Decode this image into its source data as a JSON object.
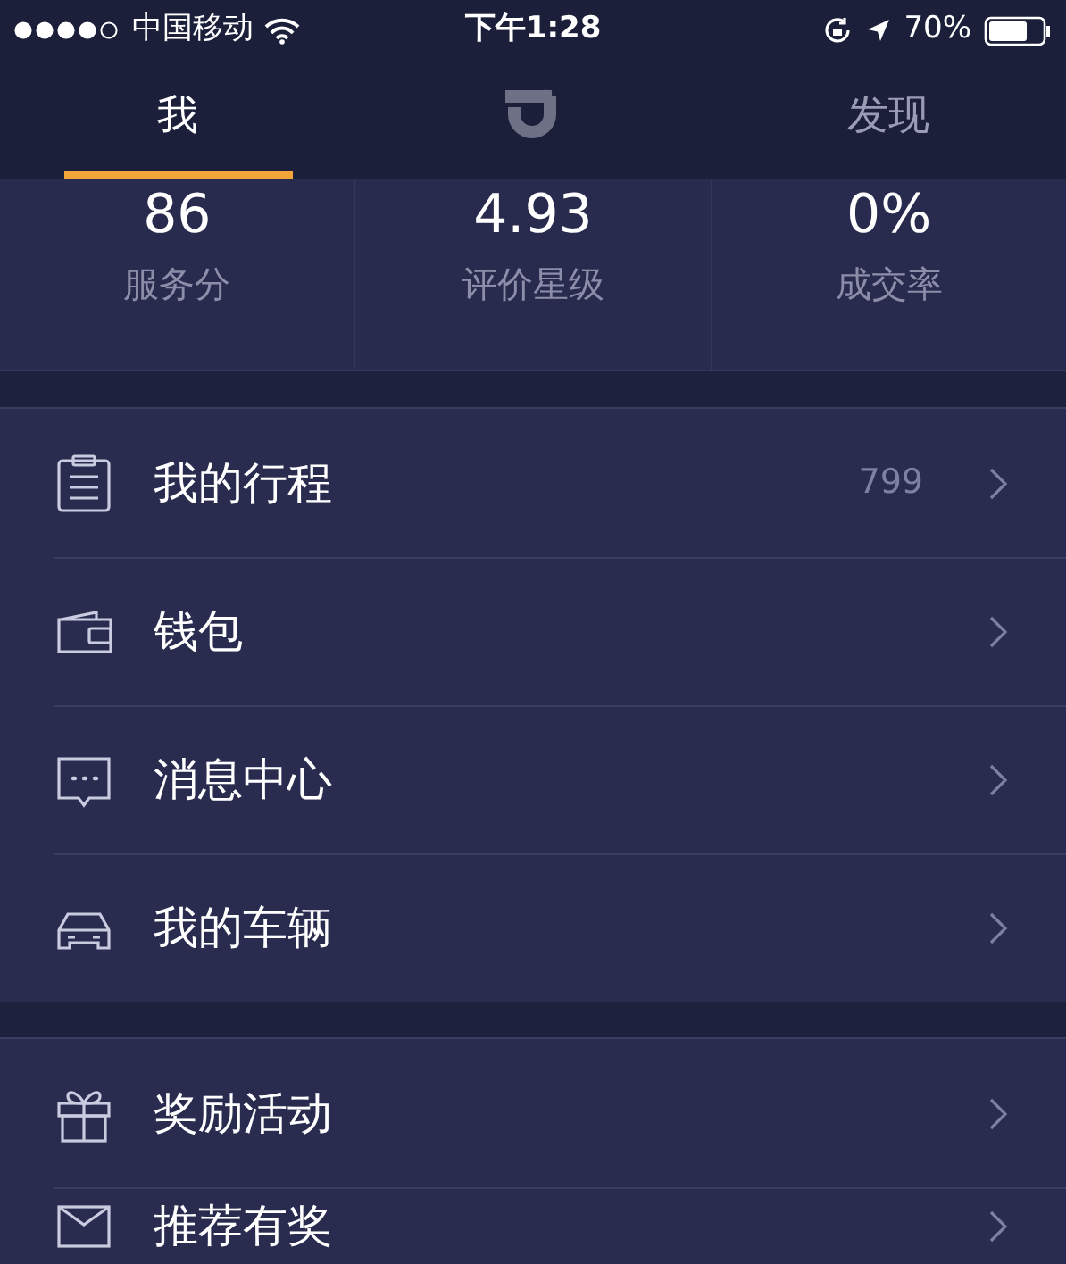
{
  "status_bar": {
    "carrier": "中国移动",
    "time": "下午1:28",
    "battery": "70%"
  },
  "tabs": [
    {
      "kind": "text",
      "label": "我",
      "selected": true
    },
    {
      "kind": "logo",
      "selected": false
    },
    {
      "kind": "text",
      "label": "发现",
      "selected": false
    }
  ],
  "stats": [
    {
      "value": "86",
      "label": "服务分"
    },
    {
      "value": "4.93",
      "label": "评价星级"
    },
    {
      "value": "0%",
      "label": "成交率"
    }
  ],
  "menu_groups": [
    {
      "items": [
        {
          "label": "我的行程",
          "count": "799"
        },
        {
          "label": "钱包"
        },
        {
          "label": "消息中心"
        },
        {
          "label": "我的车辆"
        }
      ]
    },
    {
      "items": [
        {
          "label": "奖励活动"
        },
        {
          "label": "推荐有奖"
        }
      ]
    }
  ]
}
